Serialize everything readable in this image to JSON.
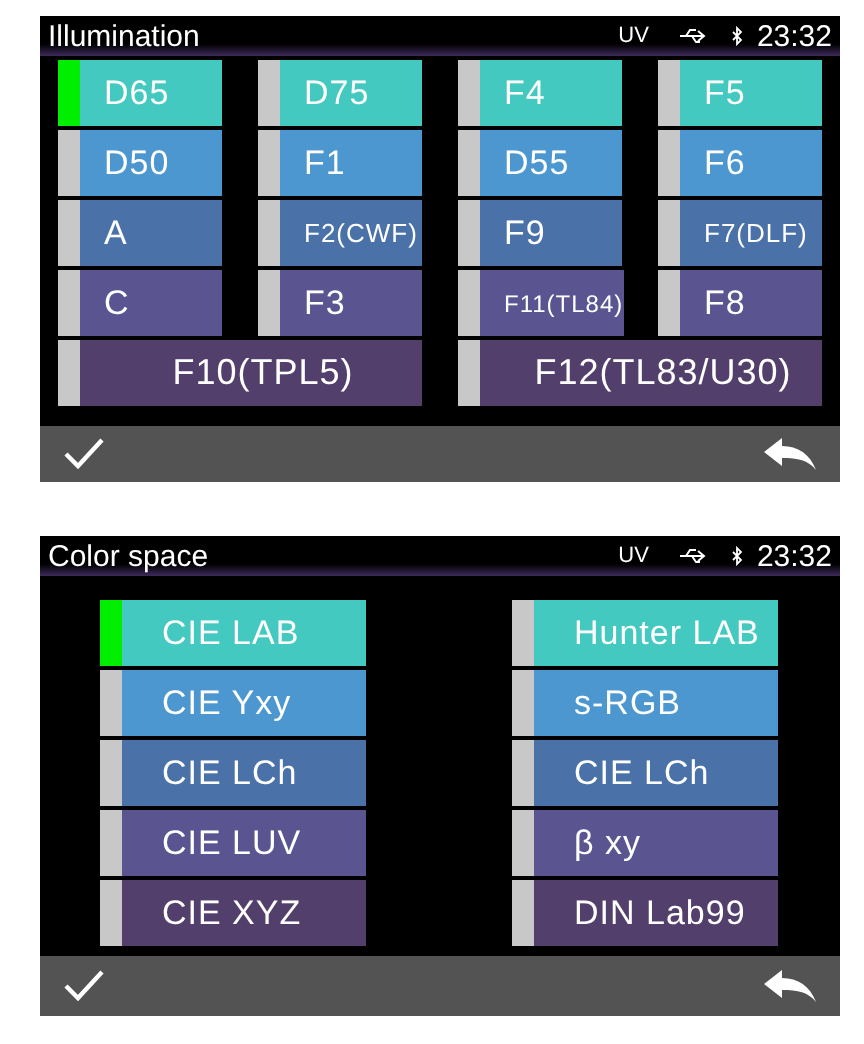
{
  "screens": [
    {
      "title": "Illumination",
      "kind": "grid",
      "status": {
        "uv": "UV",
        "time": "23:32"
      },
      "items": [
        {
          "label": "D65",
          "selected": true,
          "kind": "normal"
        },
        {
          "label": "D75",
          "selected": false,
          "kind": "normal"
        },
        {
          "label": "F4",
          "selected": false,
          "kind": "normal"
        },
        {
          "label": "F5",
          "selected": false,
          "kind": "normal"
        },
        {
          "label": "D50",
          "selected": false,
          "kind": "normal"
        },
        {
          "label": "F1",
          "selected": false,
          "kind": "normal"
        },
        {
          "label": "D55",
          "selected": false,
          "kind": "normal"
        },
        {
          "label": "F6",
          "selected": false,
          "kind": "normal"
        },
        {
          "label": "A",
          "selected": false,
          "kind": "normal"
        },
        {
          "label": "F2(CWF)",
          "selected": false,
          "kind": "normal"
        },
        {
          "label": "F9",
          "selected": false,
          "kind": "normal"
        },
        {
          "label": "F7(DLF)",
          "selected": false,
          "kind": "normal"
        },
        {
          "label": "C",
          "selected": false,
          "kind": "normal"
        },
        {
          "label": "F3",
          "selected": false,
          "kind": "normal"
        },
        {
          "label": "F11(TL84)",
          "selected": false,
          "kind": "normal"
        },
        {
          "label": "F8",
          "selected": false,
          "kind": "normal"
        },
        {
          "label": "F10(TPL5)",
          "selected": false,
          "kind": "wide"
        },
        {
          "label": "F12(TL83/U30)",
          "selected": false,
          "kind": "wide"
        }
      ]
    },
    {
      "title": "Color space",
      "kind": "list",
      "status": {
        "uv": "UV",
        "time": "23:32"
      },
      "items": [
        {
          "label": "CIE LAB",
          "selected": true,
          "kind": "normal"
        },
        {
          "label": "Hunter LAB",
          "selected": false,
          "kind": "normal"
        },
        {
          "label": "CIE Yxy",
          "selected": false,
          "kind": "normal"
        },
        {
          "label": "s-RGB",
          "selected": false,
          "kind": "normal"
        },
        {
          "label": "CIE LCh",
          "selected": false,
          "kind": "normal"
        },
        {
          "label": "CIE LCh",
          "selected": false,
          "kind": "normal"
        },
        {
          "label": "CIE LUV",
          "selected": false,
          "kind": "normal"
        },
        {
          "label": "β xy",
          "selected": false,
          "kind": "normal"
        },
        {
          "label": "CIE XYZ",
          "selected": false,
          "kind": "normal"
        },
        {
          "label": "DIN Lab99",
          "selected": false,
          "kind": "normal"
        }
      ]
    }
  ]
}
